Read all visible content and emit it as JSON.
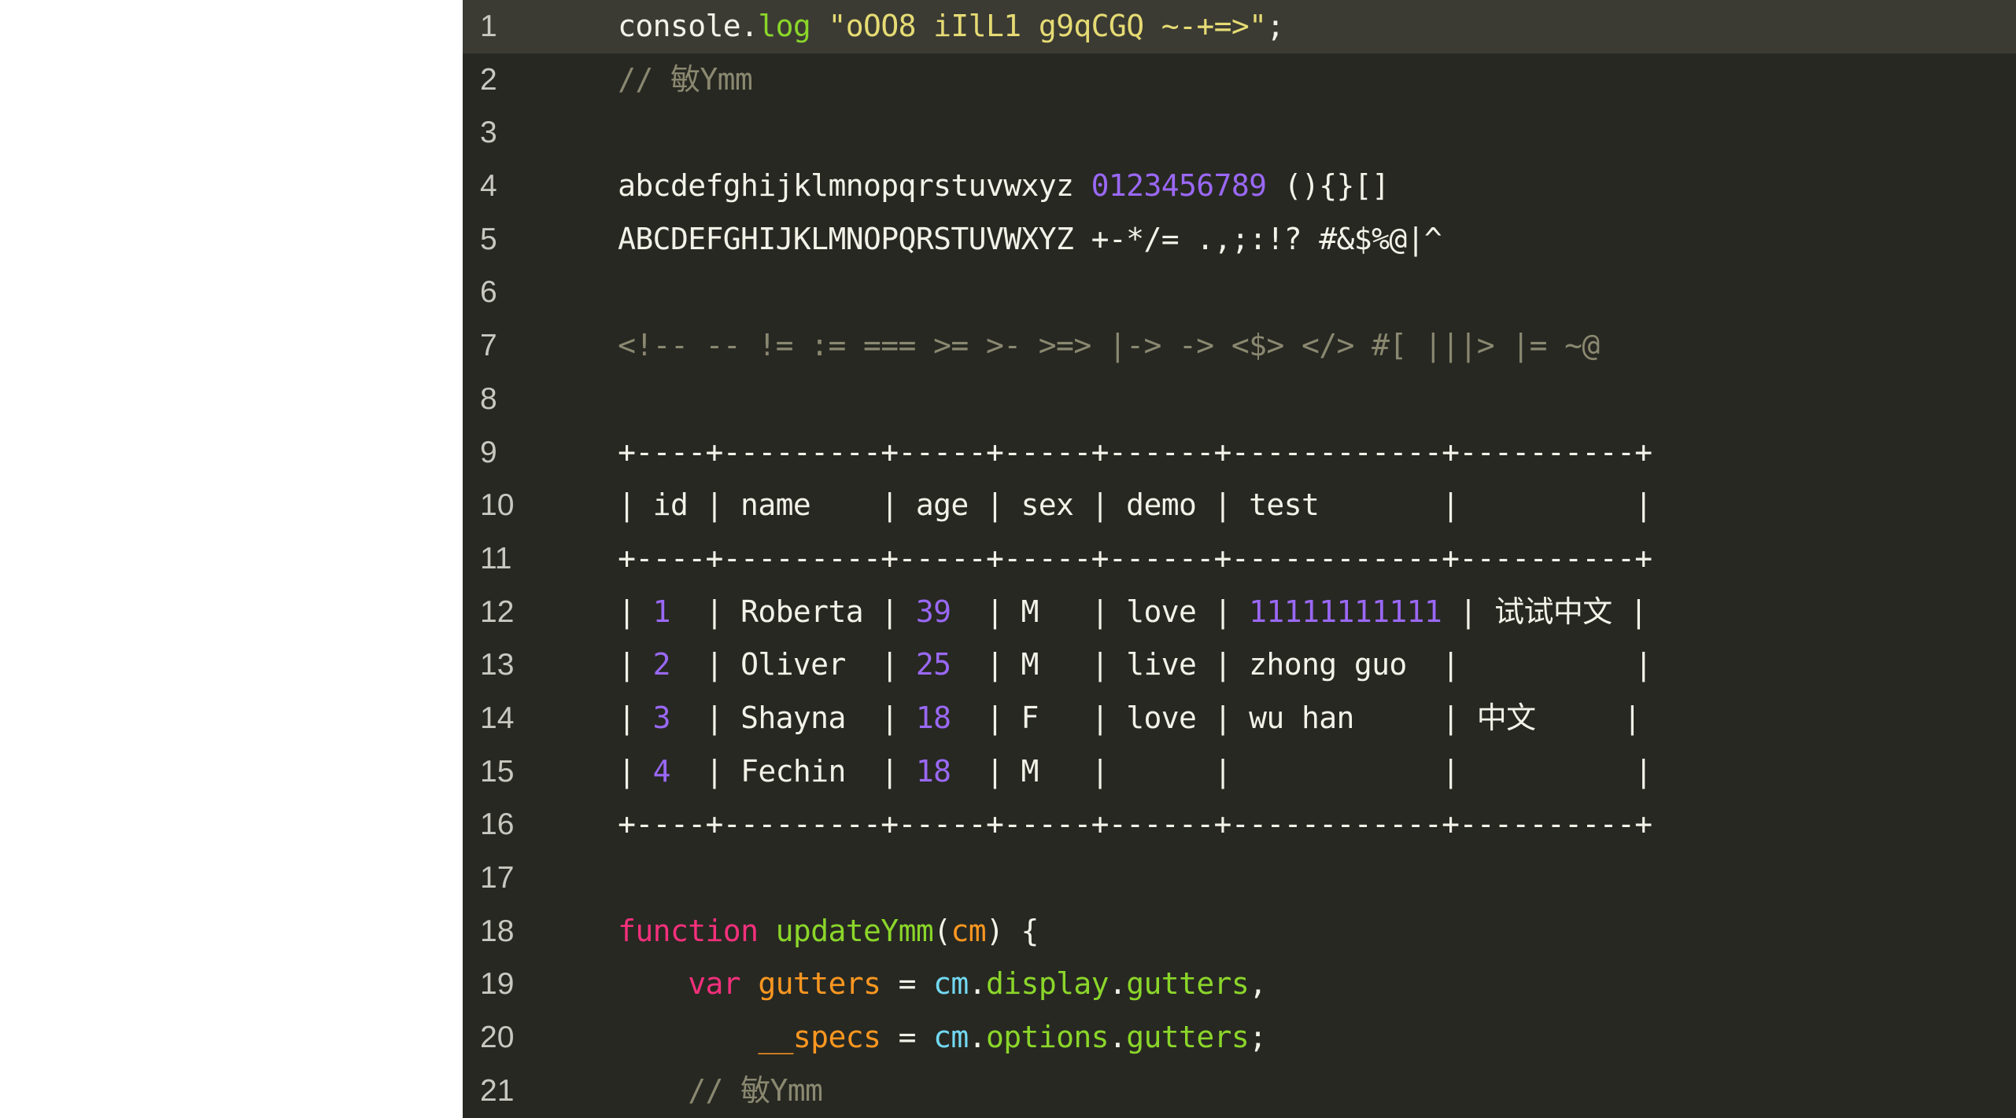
{
  "editor": {
    "background_color": "#272822",
    "active_line_background": "#3b3b33",
    "gutter_text_color": "#c8c8c0",
    "left_margin_color": "#ffffff",
    "active_line_number": 1,
    "colors": {
      "plain": "#f2f2e8",
      "keyword": "#f4307c",
      "function_name": "#fd9720",
      "variable": "#fd9720",
      "property": "#8bd62a",
      "object": "#72d9f2",
      "string": "#e6db74",
      "comment": "#8a8870",
      "number": "#9a68f5",
      "method": "#8bd62a"
    },
    "line_numbers": [
      "1",
      "2",
      "3",
      "4",
      "5",
      "6",
      "7",
      "8",
      "9",
      "10",
      "11",
      "12",
      "13",
      "14",
      "15",
      "16",
      "17",
      "18",
      "19",
      "20",
      "21"
    ],
    "lines": [
      {
        "number": "1",
        "active": true,
        "tokens": [
          {
            "text": "    ",
            "class": "t-plain"
          },
          {
            "text": "console",
            "class": "t-plain"
          },
          {
            "text": ".",
            "class": "t-plain"
          },
          {
            "text": "log",
            "class": "t-green"
          },
          {
            "text": " ",
            "class": "t-plain"
          },
          {
            "text": "\"oOO8 iIlL1 g9qCGQ ~-+=>\"",
            "class": "t-string"
          },
          {
            "text": ";",
            "class": "t-plain"
          }
        ]
      },
      {
        "number": "2",
        "active": false,
        "tokens": [
          {
            "text": "    // ",
            "class": "t-comment"
          },
          {
            "text": "敏",
            "class": "t-comment t-cjk"
          },
          {
            "text": "Ymm",
            "class": "t-comment"
          }
        ]
      },
      {
        "number": "3",
        "active": false,
        "tokens": []
      },
      {
        "number": "4",
        "active": false,
        "tokens": [
          {
            "text": "    abcdefghijklmnopqrstuvwxyz ",
            "class": "t-plain"
          },
          {
            "text": "0123456789",
            "class": "t-number"
          },
          {
            "text": " (){}[]",
            "class": "t-plain"
          }
        ]
      },
      {
        "number": "5",
        "active": false,
        "tokens": [
          {
            "text": "    ABCDEFGHIJKLMNOPQRSTUVWXYZ +-*/= .,;:!? #&$%@|^",
            "class": "t-plain"
          }
        ]
      },
      {
        "number": "6",
        "active": false,
        "tokens": []
      },
      {
        "number": "7",
        "active": false,
        "tokens": [
          {
            "text": "    <!-- -- != := === >= >- >=> |-> -> <$> </> #[ |||> |= ~@",
            "class": "t-comment"
          }
        ]
      },
      {
        "number": "8",
        "active": false,
        "tokens": []
      },
      {
        "number": "9",
        "active": false,
        "tokens": [
          {
            "text": "    +----+---------+-----+-----+------+------------+----------+",
            "class": "t-plain"
          }
        ]
      },
      {
        "number": "10",
        "active": false,
        "tokens": [
          {
            "text": "    | id | name    | age | sex | demo | test       |          |",
            "class": "t-plain"
          }
        ]
      },
      {
        "number": "11",
        "active": false,
        "tokens": [
          {
            "text": "    +----+---------+-----+-----+------+------------+----------+",
            "class": "t-plain"
          }
        ]
      },
      {
        "number": "12",
        "active": false,
        "tokens": [
          {
            "text": "    | ",
            "class": "t-plain"
          },
          {
            "text": "1",
            "class": "t-number"
          },
          {
            "text": "  | Roberta | ",
            "class": "t-plain"
          },
          {
            "text": "39",
            "class": "t-number"
          },
          {
            "text": "  | M   | love | ",
            "class": "t-plain"
          },
          {
            "text": "11111111111",
            "class": "t-number"
          },
          {
            "text": " | ",
            "class": "t-plain"
          },
          {
            "text": "试试中文",
            "class": "t-plain t-cjk"
          },
          {
            "text": " |",
            "class": "t-plain"
          }
        ]
      },
      {
        "number": "13",
        "active": false,
        "tokens": [
          {
            "text": "    | ",
            "class": "t-plain"
          },
          {
            "text": "2",
            "class": "t-number"
          },
          {
            "text": "  | Oliver  | ",
            "class": "t-plain"
          },
          {
            "text": "25",
            "class": "t-number"
          },
          {
            "text": "  | M   | live | zhong guo  |          |",
            "class": "t-plain"
          }
        ]
      },
      {
        "number": "14",
        "active": false,
        "tokens": [
          {
            "text": "    | ",
            "class": "t-plain"
          },
          {
            "text": "3",
            "class": "t-number"
          },
          {
            "text": "  | Shayna  | ",
            "class": "t-plain"
          },
          {
            "text": "18",
            "class": "t-number"
          },
          {
            "text": "  | F   | love | wu han     | ",
            "class": "t-plain"
          },
          {
            "text": "中文",
            "class": "t-plain t-cjk"
          },
          {
            "text": "     |",
            "class": "t-plain"
          }
        ]
      },
      {
        "number": "15",
        "active": false,
        "tokens": [
          {
            "text": "    | ",
            "class": "t-plain"
          },
          {
            "text": "4",
            "class": "t-number"
          },
          {
            "text": "  | Fechin  | ",
            "class": "t-plain"
          },
          {
            "text": "18",
            "class": "t-number"
          },
          {
            "text": "  | M   |      |            |          |",
            "class": "t-plain"
          }
        ]
      },
      {
        "number": "16",
        "active": false,
        "tokens": [
          {
            "text": "    +----+---------+-----+-----+------+------------+----------+",
            "class": "t-plain"
          }
        ]
      },
      {
        "number": "17",
        "active": false,
        "tokens": []
      },
      {
        "number": "18",
        "active": false,
        "tokens": [
          {
            "text": "    ",
            "class": "t-plain"
          },
          {
            "text": "function",
            "class": "t-pink"
          },
          {
            "text": " ",
            "class": "t-plain"
          },
          {
            "text": "updateYmm",
            "class": "t-lime"
          },
          {
            "text": "(",
            "class": "t-plain"
          },
          {
            "text": "cm",
            "class": "t-orange"
          },
          {
            "text": ") {",
            "class": "t-plain"
          }
        ]
      },
      {
        "number": "19",
        "active": false,
        "tokens": [
          {
            "text": "        ",
            "class": "t-plain"
          },
          {
            "text": "var",
            "class": "t-pink"
          },
          {
            "text": " ",
            "class": "t-plain"
          },
          {
            "text": "gutters",
            "class": "t-orange"
          },
          {
            "text": " = ",
            "class": "t-plain"
          },
          {
            "text": "cm",
            "class": "t-cyan"
          },
          {
            "text": ".",
            "class": "t-plain"
          },
          {
            "text": "display",
            "class": "t-lime"
          },
          {
            "text": ".",
            "class": "t-plain"
          },
          {
            "text": "gutters",
            "class": "t-lime"
          },
          {
            "text": ",",
            "class": "t-plain"
          }
        ]
      },
      {
        "number": "20",
        "active": false,
        "tokens": [
          {
            "text": "            ",
            "class": "t-plain"
          },
          {
            "text": "__specs",
            "class": "t-orange"
          },
          {
            "text": " = ",
            "class": "t-plain"
          },
          {
            "text": "cm",
            "class": "t-cyan"
          },
          {
            "text": ".",
            "class": "t-plain"
          },
          {
            "text": "options",
            "class": "t-lime"
          },
          {
            "text": ".",
            "class": "t-plain"
          },
          {
            "text": "gutters",
            "class": "t-lime"
          },
          {
            "text": ";",
            "class": "t-plain"
          }
        ]
      },
      {
        "number": "21",
        "active": false,
        "tokens": [
          {
            "text": "        // ",
            "class": "t-comment"
          },
          {
            "text": "敏",
            "class": "t-comment t-cjk"
          },
          {
            "text": "Ymm",
            "class": "t-comment"
          }
        ]
      }
    ]
  }
}
